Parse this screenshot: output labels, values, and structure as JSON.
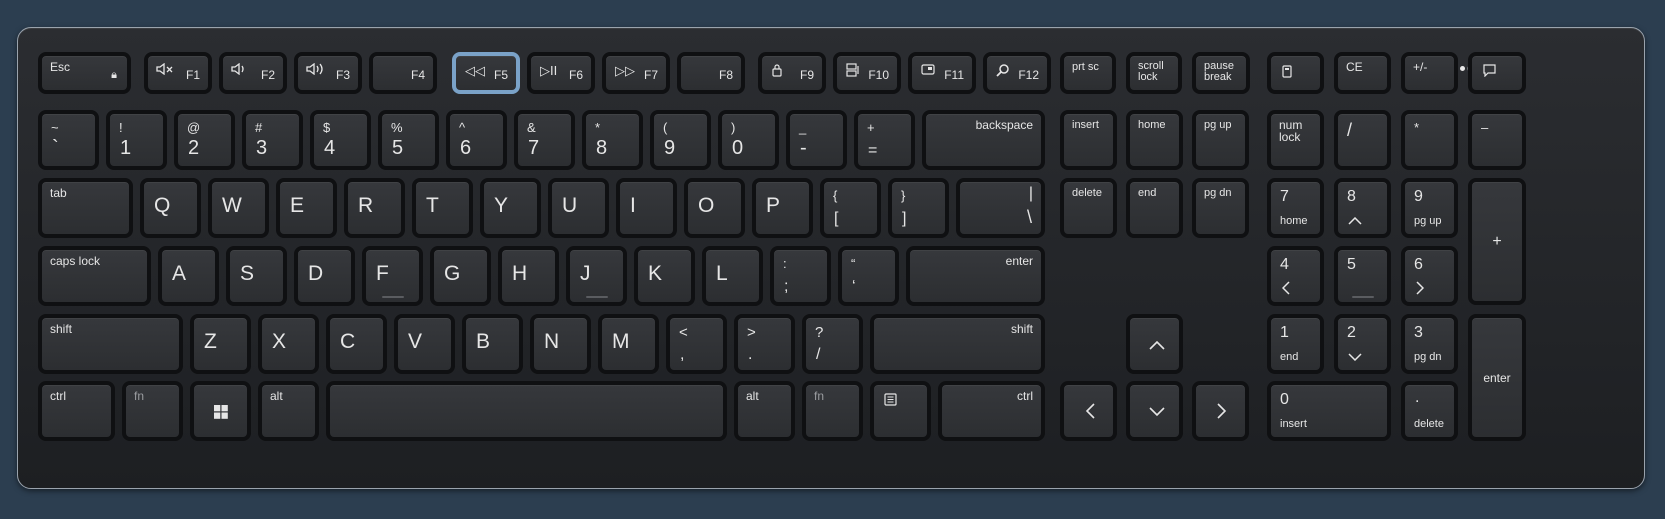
{
  "keyboard": {
    "function_row": {
      "esc": "Esc",
      "f1": "F1",
      "f2": "F2",
      "f3": "F3",
      "f4": "F4",
      "f5": "F5",
      "f6": "F6",
      "f7": "F7",
      "f8": "F8",
      "f9": "F9",
      "f10": "F10",
      "f11": "F11",
      "f12": "F12",
      "prtsc": "prt sc",
      "scroll_lock": "scroll\nlock",
      "pause_break": "pause\nbreak",
      "ce": "CE",
      "plus_minus": "+/-",
      "icons": [
        "lock-icon",
        "mute-icon",
        "volume-down-icon",
        "volume-up-icon",
        "rewind-icon",
        "play-pause-icon",
        "fast-forward-icon",
        "padlock-icon",
        "display-icon",
        "window-icon",
        "search-icon",
        "calculator-icon",
        "chat-icon"
      ]
    },
    "number_row": {
      "tilde_top": "~",
      "tilde_bottom": "`",
      "k1_top": "!",
      "k1": "1",
      "k2_top": "@",
      "k2": "2",
      "k3_top": "#",
      "k3": "3",
      "k4_top": "$",
      "k4": "4",
      "k5_top": "%",
      "k5": "5",
      "k6_top": "^",
      "k6": "6",
      "k7_top": "&",
      "k7": "7",
      "k8_top": "*",
      "k8": "8",
      "k9_top": "(",
      "k9": "9",
      "k0_top": ")",
      "k0": "0",
      "minus_top": "_",
      "minus": "-",
      "equals_top": "+",
      "equals": "=",
      "backspace": "backspace"
    },
    "top_row": {
      "tab": "tab",
      "letters": [
        "Q",
        "W",
        "E",
        "R",
        "T",
        "Y",
        "U",
        "I",
        "O",
        "P"
      ],
      "lbrace_top": "{",
      "lbrace": "[",
      "rbrace_top": "}",
      "rbrace": "]",
      "pipe_top": "|",
      "pipe": "\\"
    },
    "home_row": {
      "caps": "caps lock",
      "letters": [
        "A",
        "S",
        "D",
        "F",
        "G",
        "H",
        "J",
        "K",
        "L"
      ],
      "colon_top": ":",
      "colon": ";",
      "quote_top": "“",
      "quote": "‘",
      "enter": "enter"
    },
    "bottom_row": {
      "shift": "shift",
      "letters": [
        "Z",
        "X",
        "C",
        "V",
        "B",
        "N",
        "M"
      ],
      "lt_top": "<",
      "lt": ",",
      "gt_top": ">",
      "gt": ".",
      "q_top": "?",
      "q": "/",
      "rshift": "shift"
    },
    "space_row": {
      "ctrl": "ctrl",
      "fn": "fn",
      "alt": "alt",
      "ralt": "alt",
      "rfn": "fn",
      "rctrl": "ctrl"
    },
    "nav_cluster": {
      "insert": "insert",
      "home": "home",
      "pgup": "pg up",
      "delete": "delete",
      "end": "end",
      "pgdn": "pg dn"
    },
    "numpad": {
      "numlock": "num\nlock",
      "slash": "/",
      "star": "*",
      "minus": "–",
      "plus": "+",
      "n7": "7",
      "n7_sub": "home",
      "n8": "8",
      "n9": "9",
      "n9_sub": "pg up",
      "n4": "4",
      "n5": "5",
      "n6": "6",
      "n1": "1",
      "n1_sub": "end",
      "n2": "2",
      "n3": "3",
      "n3_sub": "pg dn",
      "n0": "0",
      "n0_sub": "insert",
      "dot": ".",
      "dot_sub": "delete",
      "enter": "enter"
    }
  },
  "colors": {
    "background": "#2c3e50",
    "keyboard_body": "#222427",
    "key": "#313337",
    "key_border": "#0f1012",
    "highlight": "#7aa2c8",
    "legend": "#e6e6e6"
  }
}
